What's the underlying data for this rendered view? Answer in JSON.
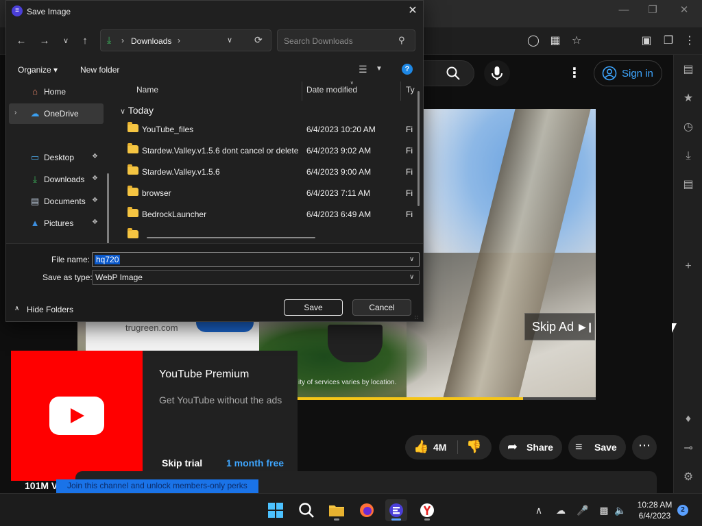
{
  "dialog": {
    "title": "Save Image",
    "address": {
      "path": "Downloads"
    },
    "search_placeholder": "Search Downloads",
    "commands": {
      "organize": "Organize",
      "new_folder": "New folder"
    },
    "nav_items": [
      {
        "label": "Home",
        "icon": "home-icon"
      },
      {
        "label": "OneDrive",
        "icon": "cloud-icon"
      },
      {
        "label": "Desktop",
        "icon": "desktop-icon"
      },
      {
        "label": "Downloads",
        "icon": "download-icon"
      },
      {
        "label": "Documents",
        "icon": "documents-icon"
      },
      {
        "label": "Pictures",
        "icon": "pictures-icon"
      }
    ],
    "columns": {
      "name": "Name",
      "date_modified": "Date modified",
      "type": "Ty"
    },
    "group_label": "Today",
    "files": [
      {
        "name": "YouTube_files",
        "date": "6/4/2023 10:20 AM",
        "type": "Fi"
      },
      {
        "name": "Stardew.Valley.v1.5.6 dont cancel or delete",
        "date": "6/4/2023 9:02 AM",
        "type": "Fi"
      },
      {
        "name": "Stardew.Valley.v1.5.6",
        "date": "6/4/2023 9:00 AM",
        "type": "Fi"
      },
      {
        "name": "browser",
        "date": "6/4/2023 7:11 AM",
        "type": "Fi"
      },
      {
        "name": "BedrockLauncher",
        "date": "6/4/2023 6:49 AM",
        "type": "Fi"
      }
    ],
    "file_name_label": "File name:",
    "file_name_value": "hq720",
    "save_type_label": "Save as type:",
    "save_type_value": "WebP Image",
    "hide_folders": "Hide Folders",
    "save_label": "Save",
    "cancel_label": "Cancel"
  },
  "youtube": {
    "sign_in": "Sign in",
    "ad": {
      "skip_label": "Skip Ad",
      "advertiser_url": "trugreen.com",
      "disclaimer": "ity of services varies by location.",
      "progress": 0.86
    },
    "premium": {
      "title": "YouTube Premium",
      "subtitle": "Get YouTube without the ads",
      "skip_label": "Skip trial",
      "offer_label": "1 month free"
    },
    "actions": {
      "likes": "4M",
      "share": "Share",
      "save": "Save"
    },
    "subscribers": "101M V",
    "join_banner": "Join this channel and unlock members-only perks"
  },
  "taskbar": {
    "time": "10:28 AM",
    "date": "6/4/2023",
    "notification_count": "2"
  }
}
